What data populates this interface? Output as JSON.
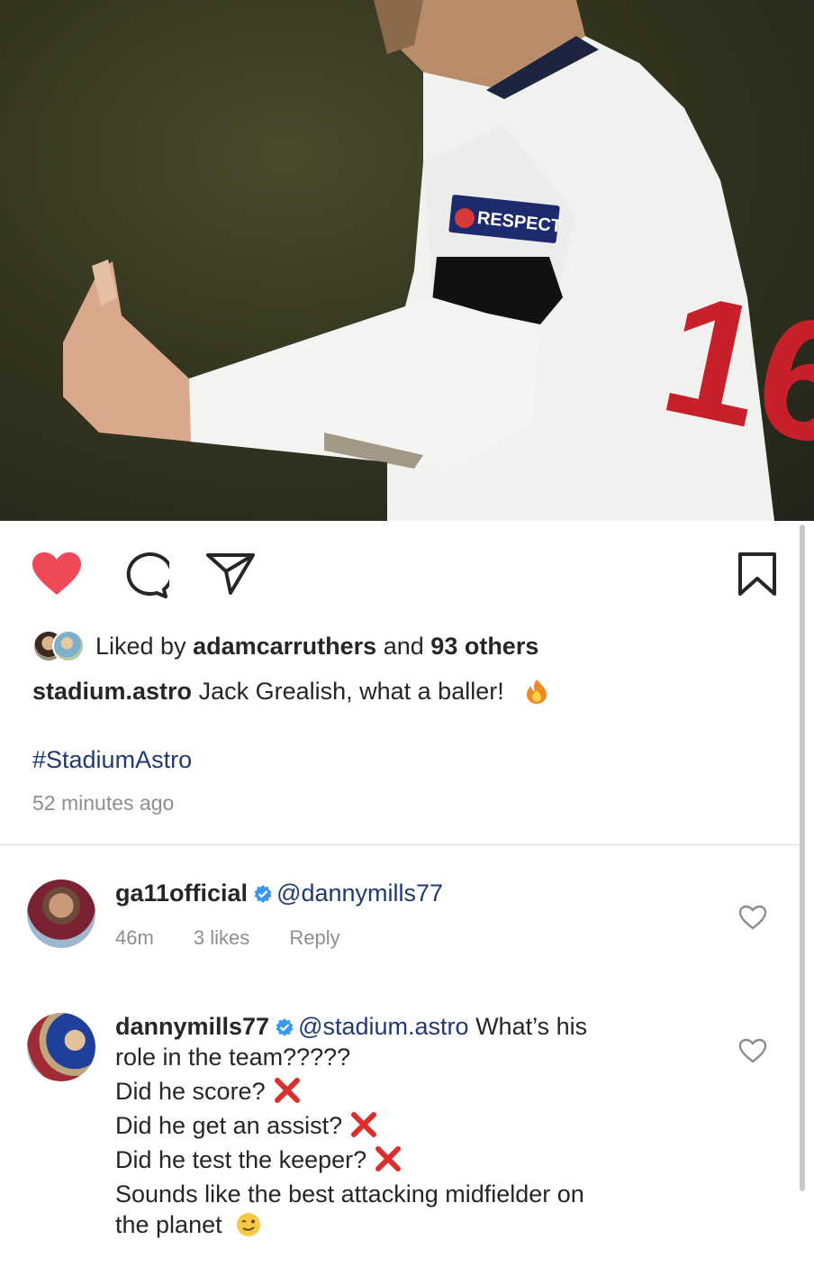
{
  "post": {
    "image_alt": "Player giving thumbs up",
    "armband_text": "RESPECT",
    "shirt_number": "16",
    "liked_by_prefix": "Liked by",
    "liked_by_user": "adamcarruthers",
    "liked_by_mid": "and",
    "liked_by_others": "93 others",
    "caption_user": "stadium.astro",
    "caption_text": "Jack Grealish, what a baller!",
    "hashtag": "#StadiumAstro",
    "time_ago": "52 minutes ago"
  },
  "icons": {
    "like": "heart-filled-icon",
    "comment": "comment-icon",
    "share": "send-icon",
    "save": "bookmark-icon"
  },
  "colors": {
    "like_red": "#ed4956",
    "link_blue": "#1f3a6e",
    "verified_blue": "#3897f0",
    "muted": "#8e8e8e"
  },
  "comments": [
    {
      "user": "ga11official",
      "mention": "@dannymills77",
      "text": "",
      "time": "46m",
      "likes": "3 likes",
      "reply": "Reply"
    },
    {
      "user": "dannymills77",
      "mention": "@stadium.astro",
      "text_line1": "What’s his",
      "text_line2": "role in the team?????",
      "q1": "Did he score?",
      "q2": "Did he get an assist?",
      "q3": "Did he test the keeper?",
      "text_line6": "Sounds like the best attacking midfielder on",
      "text_line7": "the planet"
    }
  ]
}
